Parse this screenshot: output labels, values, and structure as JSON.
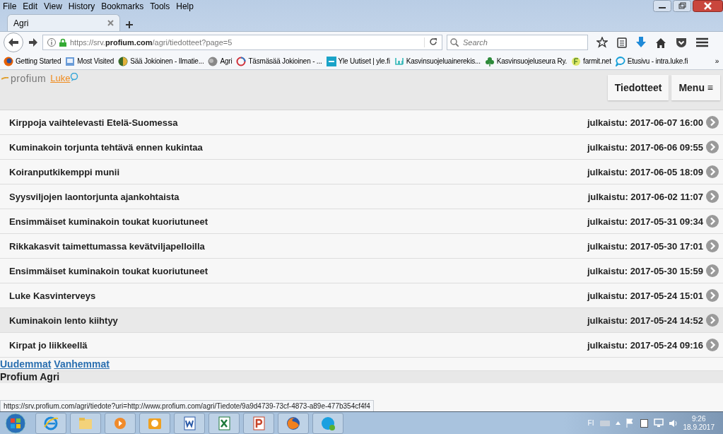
{
  "menu_bar": [
    "File",
    "Edit",
    "View",
    "History",
    "Bookmarks",
    "Tools",
    "Help"
  ],
  "tabs": [
    {
      "label": "Agri",
      "selected": true
    }
  ],
  "address_bar": {
    "url": "https://srv.**profium.com**/agri/tiedotteet?page=5"
  },
  "search": {
    "placeholder": "Search"
  },
  "bookmarks": [
    {
      "label": "Getting Started"
    },
    {
      "label": "Most Visited"
    },
    {
      "label": "Sää Jokioinen - Ilmatie..."
    },
    {
      "label": "Agri"
    },
    {
      "label": "Täsmäsää Jokioinen - ..."
    },
    {
      "label": "Yle Uutiset | yle.fi"
    },
    {
      "label": "Kasvinsuojeluainerekis..."
    },
    {
      "label": "Kasvinsuojeluseura Ry."
    },
    {
      "label": "farmit.net"
    },
    {
      "label": "Etusivu - intra.luke.fi"
    }
  ],
  "bookmarks_overflow": "»",
  "header": {
    "logo_text": "profium",
    "logo_partner": "Luke",
    "buttons": [
      "Tiedotteet",
      "Menu ≡"
    ]
  },
  "announcements": [
    {
      "title": "Kirppoja vaihtelevasti Etelä-Suomessa",
      "published": "julkaistu: 2017-06-07 16:00",
      "hovered": false
    },
    {
      "title": "Kuminakoin torjunta tehtävä ennen kukintaa",
      "published": "julkaistu: 2017-06-06 09:55",
      "hovered": false
    },
    {
      "title": "Koiranputkikemppi munii",
      "published": "julkaistu: 2017-06-05 18:09",
      "hovered": false
    },
    {
      "title": "Syysviljojen laontorjunta ajankohtaista",
      "published": "julkaistu: 2017-06-02 11:07",
      "hovered": false
    },
    {
      "title": "Ensimmäiset kuminakoin toukat kuoriutuneet",
      "published": "julkaistu: 2017-05-31 09:34",
      "hovered": false
    },
    {
      "title": "Rikkakasvit taimettumassa kevätviljapelloilla",
      "published": "julkaistu: 2017-05-30 17:01",
      "hovered": false
    },
    {
      "title": "Ensimmäiset kuminakoin toukat kuoriutuneet",
      "published": "julkaistu: 2017-05-30 15:59",
      "hovered": false
    },
    {
      "title": "Luke Kasvinterveys",
      "published": "julkaistu: 2017-05-24 15:01",
      "hovered": false
    },
    {
      "title": "Kuminakoin lento kiihtyy",
      "published": "julkaistu: 2017-05-24 14:52",
      "hovered": true
    },
    {
      "title": "Kirpat jo liikkeellä",
      "published": "julkaistu: 2017-05-24 09:16",
      "hovered": false
    }
  ],
  "pager": [
    "Uudemmat",
    "Vanhemmat"
  ],
  "footer": "Profium Agri",
  "status_url": "https://srv.profium.com/agri/tiedote?uri=http://www.profium.com/agri/Tiedote/9a9d4739-73cf-4873-a89e-477b354cf4f4",
  "taskbar": {
    "language": "FI",
    "time": "9:26",
    "date": "18.9.2017"
  }
}
